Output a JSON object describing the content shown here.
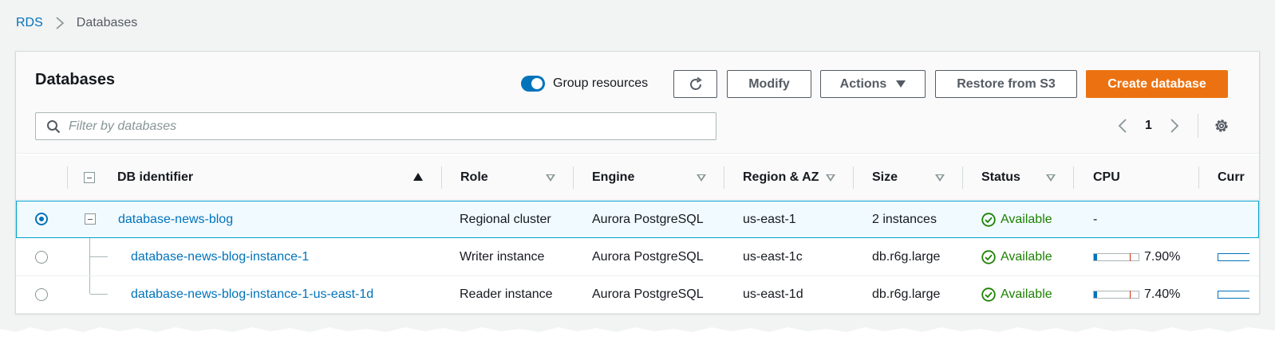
{
  "breadcrumb": {
    "root": "RDS",
    "current": "Databases"
  },
  "panel": {
    "title": "Databases",
    "group_resources_label": "Group resources",
    "group_resources_on": true,
    "buttons": {
      "modify": "Modify",
      "actions": "Actions",
      "restore": "Restore from S3",
      "create": "Create database"
    },
    "search_placeholder": "Filter by databases",
    "page": "1"
  },
  "columns": [
    "DB identifier",
    "Role",
    "Engine",
    "Region & AZ",
    "Size",
    "Status",
    "CPU",
    "Curr"
  ],
  "rows": [
    {
      "id": "database-news-blog",
      "role": "Regional cluster",
      "engine": "Aurora PostgreSQL",
      "region": "us-east-1",
      "size": "2 instances",
      "status": "Available",
      "cpu": "-",
      "selected": true
    },
    {
      "id": "database-news-blog-instance-1",
      "role": "Writer instance",
      "engine": "Aurora PostgreSQL",
      "region": "us-east-1c",
      "size": "db.r6g.large",
      "status": "Available",
      "cpu": "7.90%",
      "cpu_value": 0.079,
      "selected": false
    },
    {
      "id": "database-news-blog-instance-1-us-east-1d",
      "role": "Reader instance",
      "engine": "Aurora PostgreSQL",
      "region": "us-east-1d",
      "size": "db.r6g.large",
      "status": "Available",
      "cpu": "7.40%",
      "cpu_value": 0.074,
      "selected": false
    }
  ],
  "colors": {
    "accent": "#0073bb",
    "primary_button": "#ec7211",
    "status_ok": "#1d8102"
  },
  "icons": [
    "chevron-right-icon",
    "refresh-icon",
    "caret-down-icon",
    "search-icon",
    "chevron-left-icon",
    "gear-icon",
    "check-circle-icon",
    "mouse-pointer-icon"
  ]
}
